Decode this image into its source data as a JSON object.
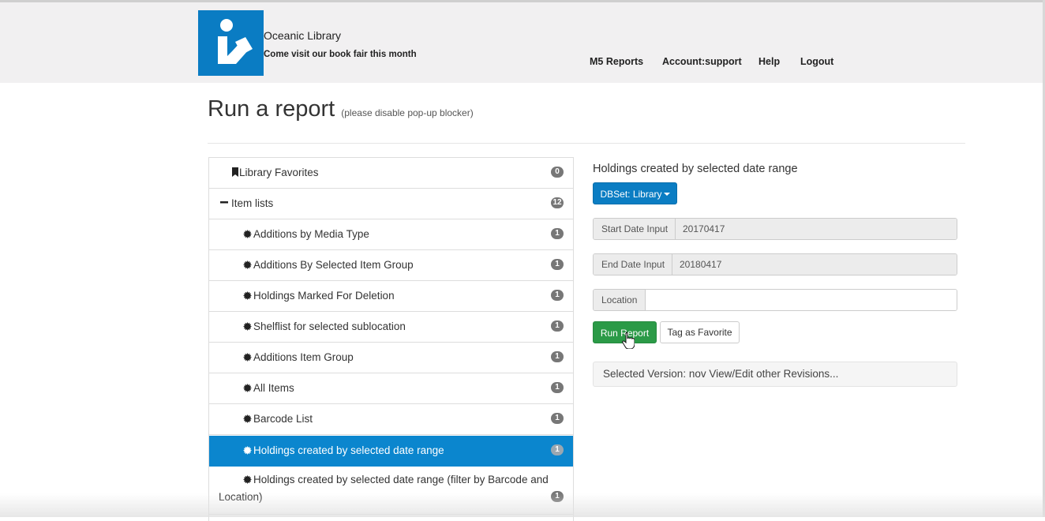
{
  "brand": {
    "name": "Oceanic Library",
    "tagline": "Come visit our book fair this month",
    "logo_color": "#0a7cc3"
  },
  "nav": {
    "reports": "M5 Reports",
    "account": "Account:support",
    "help": "Help",
    "logout": "Logout"
  },
  "page": {
    "title": "Run a report",
    "subtitle": "(please disable pop-up blocker)"
  },
  "report_list": {
    "favorites": {
      "label": "Library Favorites",
      "count": "0",
      "icon": "bookmark-icon"
    },
    "item_lists": {
      "label": "Item lists",
      "count": "12",
      "icon": "minus-icon"
    },
    "items": [
      {
        "label": "Additions by Media Type",
        "count": "1"
      },
      {
        "label": "Additions By Selected Item Group",
        "count": "1"
      },
      {
        "label": "Holdings Marked For Deletion",
        "count": "1"
      },
      {
        "label": "Shelflist for selected sublocation",
        "count": "1"
      },
      {
        "label": "Additions Item Group",
        "count": "1"
      },
      {
        "label": "All Items",
        "count": "1"
      },
      {
        "label": "Barcode List",
        "count": "1"
      },
      {
        "label": "Holdings created by selected date range",
        "count": "1",
        "active": true
      },
      {
        "label": "Holdings created by selected date range (filter by Barcode and Location)",
        "count": "1"
      }
    ],
    "item_icon": "gear-icon",
    "active_color": "#0b86ce"
  },
  "panel": {
    "title": "Holdings created by selected date range",
    "dbset_label": "DBSet: Library",
    "start_date": {
      "label": "Start Date Input",
      "value": "20170417"
    },
    "end_date": {
      "label": "End Date Input",
      "value": "20180417"
    },
    "location": {
      "label": "Location",
      "value": ""
    },
    "run_label": "Run Report",
    "favorite_label": "Tag as Favorite",
    "version_text": "Selected Version: nov View/Edit other Revisions..."
  },
  "colors": {
    "primary": "#0b7dc3",
    "success": "#2b9a47",
    "header_bg": "#f1f0f1"
  }
}
